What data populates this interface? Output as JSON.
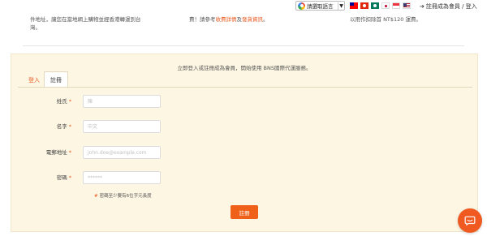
{
  "topbar": {
    "translate_label": "請選取語言",
    "translate_caret": "▼",
    "login_text": "註冊成為會員 / 登入",
    "flags": [
      "taiwan-flag",
      "hong-kong-flag",
      "macau-flag",
      "japan-flag",
      "singapore-flag",
      "us-flag"
    ]
  },
  "info": {
    "col1_line1": "件地址，讓您在當地網上購物並經香港轉運到台",
    "col1_line2": "灣。",
    "col2_prefix": "費！請參考",
    "col2_link1": "收費詳情",
    "col2_mid": "及",
    "col2_link2": "發貨資訊",
    "col2_suffix": "。",
    "col3_line1": "以用作扣除首 NT$120 運費。"
  },
  "panel": {
    "message": "立即登入或註冊成為會員，開始使用 BNS國際代運服務。",
    "tabs": [
      {
        "label": "登入",
        "active": false
      },
      {
        "label": "註冊",
        "active": true
      }
    ],
    "fields": [
      {
        "label": "姓氏",
        "required_mark": "*",
        "placeholder": "陳"
      },
      {
        "label": "名字",
        "required_mark": "*",
        "placeholder": "中文"
      },
      {
        "label": "電郵地址",
        "required_mark": "*",
        "placeholder": "john.doe@example.com"
      },
      {
        "label": "密碼",
        "required_mark": "*",
        "placeholder": "******"
      }
    ],
    "hint_bullet": "#",
    "hint": "密碼至少要有6位字元長度",
    "submit_label": "註冊"
  },
  "colors": {
    "accent": "#ef6118",
    "panel_bg": "#fdf6e3"
  },
  "chat": {
    "icon": "chat-icon"
  }
}
